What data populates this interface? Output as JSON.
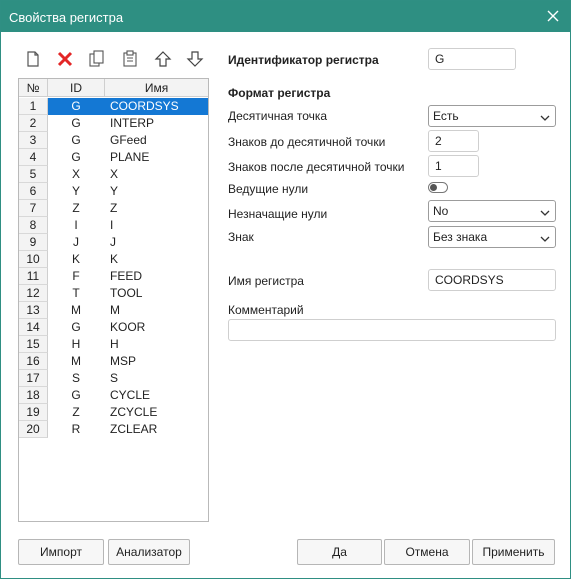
{
  "window": {
    "title": "Свойства регистра"
  },
  "toolbar": {
    "icons": [
      "new-file-icon",
      "delete-icon",
      "copy-icon",
      "paste-icon",
      "move-up-icon",
      "move-down-icon"
    ]
  },
  "table": {
    "headers": [
      "№",
      "ID",
      "Имя"
    ],
    "rows": [
      {
        "num": "1",
        "id": "G",
        "name": "COORDSYS"
      },
      {
        "num": "2",
        "id": "G",
        "name": "INTERP"
      },
      {
        "num": "3",
        "id": "G",
        "name": "GFeed"
      },
      {
        "num": "4",
        "id": "G",
        "name": "PLANE"
      },
      {
        "num": "5",
        "id": "X",
        "name": "X"
      },
      {
        "num": "6",
        "id": "Y",
        "name": "Y"
      },
      {
        "num": "7",
        "id": "Z",
        "name": "Z"
      },
      {
        "num": "8",
        "id": "I",
        "name": "I"
      },
      {
        "num": "9",
        "id": "J",
        "name": "J"
      },
      {
        "num": "10",
        "id": "K",
        "name": "K"
      },
      {
        "num": "11",
        "id": "F",
        "name": "FEED"
      },
      {
        "num": "12",
        "id": "T",
        "name": "TOOL"
      },
      {
        "num": "13",
        "id": "M",
        "name": "M"
      },
      {
        "num": "14",
        "id": "G",
        "name": "KOOR"
      },
      {
        "num": "15",
        "id": "H",
        "name": "H"
      },
      {
        "num": "16",
        "id": "M",
        "name": "MSP"
      },
      {
        "num": "17",
        "id": "S",
        "name": "S"
      },
      {
        "num": "18",
        "id": "G",
        "name": "CYCLE"
      },
      {
        "num": "19",
        "id": "Z",
        "name": "ZCYCLE"
      },
      {
        "num": "20",
        "id": "R",
        "name": "ZCLEAR"
      }
    ],
    "selected_index": 0
  },
  "form": {
    "identifier_label": "Идентификатор регистра",
    "identifier_value": "G",
    "format_heading": "Формат регистра",
    "decimal_point_label": "Десятичная точка",
    "decimal_point_value": "Есть",
    "digits_before_label": "Знаков до десятичной точки",
    "digits_before_value": "2",
    "digits_after_label": "Знаков после десятичной точки",
    "digits_after_value": "1",
    "leading_zeros_label": "Ведущие нули",
    "leading_zeros_on": false,
    "trailing_zeros_label": "Незначащие нули",
    "trailing_zeros_value": "No",
    "sign_label": "Знак",
    "sign_value": "Без знака",
    "register_name_label": "Имя регистра",
    "register_name_value": "COORDSYS",
    "comment_label": "Комментарий",
    "comment_value": ""
  },
  "buttons": {
    "import": "Импорт",
    "analyzer": "Анализатор",
    "ok": "Да",
    "cancel": "Отмена",
    "apply": "Применить"
  }
}
